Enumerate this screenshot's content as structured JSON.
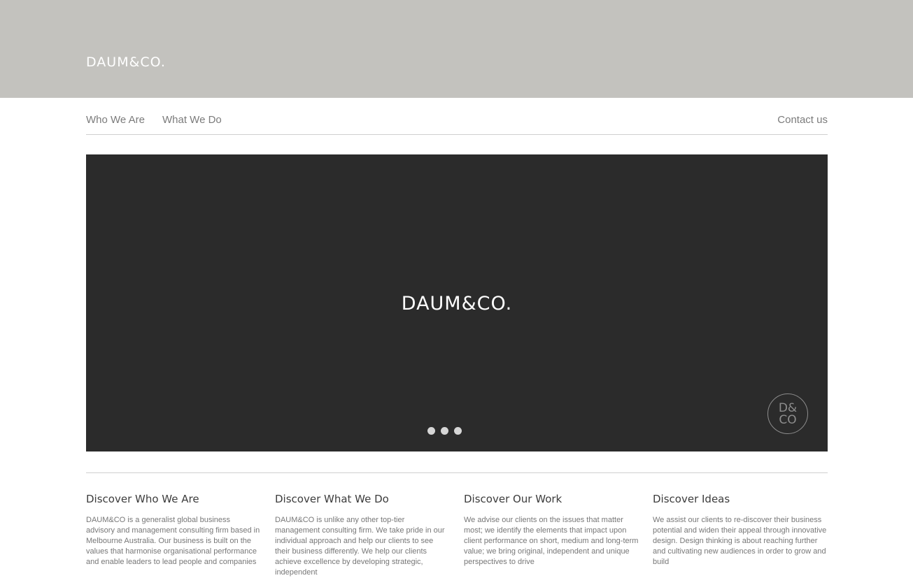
{
  "header": {
    "brand": "DAUM&CO."
  },
  "nav": {
    "who": "Who We Are",
    "what": "What We Do",
    "contact": "Contact us"
  },
  "hero": {
    "logo": "DAUM&CO.",
    "badge_top": "D&",
    "badge_bottom": "CO",
    "slide_count": 3
  },
  "columns": [
    {
      "title": "Discover Who We Are",
      "text": "DAUM&CO is a generalist global business advisory and management consulting firm based in Melbourne Australia. Our business is built on the values that harmonise organisational performance and enable leaders to lead people and companies"
    },
    {
      "title": "Discover What We Do",
      "text": "DAUM&CO is unlike any other top-tier management consulting firm. We take pride in our individual approach and help our clients to see their business differently. We help our clients achieve excellence by developing strategic, independent"
    },
    {
      "title": "Discover Our Work",
      "text": "We advise our clients on the issues that matter most; we identify the elements that impact upon client performance on short, medium and long-term value; we bring original, independent and unique perspectives to drive"
    },
    {
      "title": "Discover Ideas",
      "text": "We assist our clients to re-discover their business potential and widen their appeal through innovative design. Design thinking is about reaching further and cultivating new audiences in order to grow and build"
    }
  ]
}
